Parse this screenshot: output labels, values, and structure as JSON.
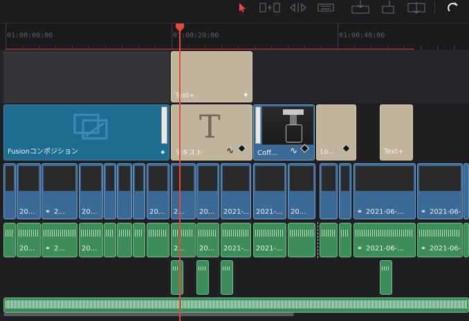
{
  "ruler": {
    "tc1": "01:00:00:00",
    "tc2": "01:00:20:00",
    "tc3": "01:00:40:00"
  },
  "colors": {
    "accent_red": "#e5483c",
    "text_plus": "#c0b49c",
    "fusion": "#1e6c8f",
    "video": "#3c6a96",
    "audio": "#3d8d5b"
  },
  "toolbar": {
    "icons": [
      "selection-pointer-icon",
      "trim-icon",
      "dynamic-trim-icon",
      "blade-icon",
      "insert-clip-icon",
      "overwrite-clip-icon",
      "replace-clip-icon",
      "snapping-icon"
    ]
  },
  "track_v3": {
    "clip1": "Text+"
  },
  "track_v2": {
    "fusion": "Fusionコンポジション",
    "text": "テキスト",
    "coffee": "Coff...",
    "lo": "Lo...",
    "textplus": "Text+"
  },
  "video_labels": [
    "20...",
    "2...",
    "20...",
    "20...",
    "2...",
    "20...",
    "2021-...",
    "2021-...",
    "20...",
    "2021-06-...",
    "2021-06-..."
  ],
  "audio_labels": [
    "20...",
    "2...",
    "20...",
    "2...",
    "20...",
    "2021-...",
    "2021-...",
    "2021-06-...",
    "2021-06-..."
  ]
}
